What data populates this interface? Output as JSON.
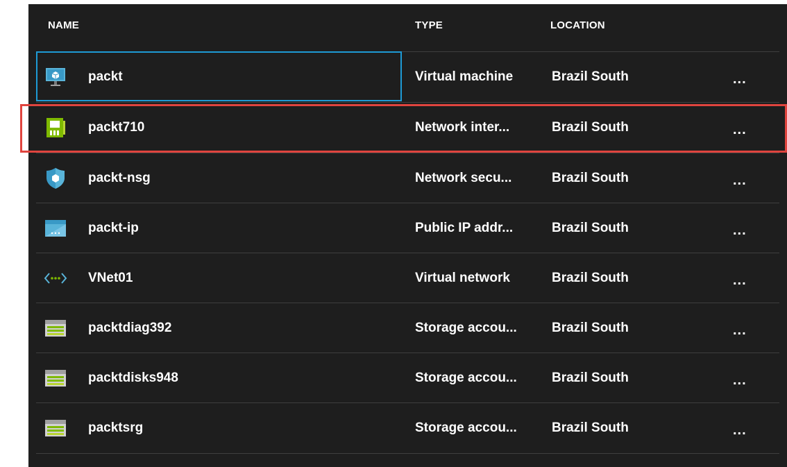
{
  "header": {
    "name": "NAME",
    "type": "TYPE",
    "location": "LOCATION"
  },
  "rows": [
    {
      "name": "packt",
      "type": "Virtual machine",
      "location": "Brazil South",
      "icon": "virtual-machine-icon",
      "more": "..."
    },
    {
      "name": "packt710",
      "type": "Network inter...",
      "location": "Brazil South",
      "icon": "network-interface-icon",
      "more": "..."
    },
    {
      "name": "packt-nsg",
      "type": "Network secu...",
      "location": "Brazil South",
      "icon": "shield-icon",
      "more": "..."
    },
    {
      "name": "packt-ip",
      "type": "Public IP addr...",
      "location": "Brazil South",
      "icon": "public-ip-icon",
      "more": "..."
    },
    {
      "name": "VNet01",
      "type": "Virtual network",
      "location": "Brazil South",
      "icon": "virtual-network-icon",
      "more": "..."
    },
    {
      "name": "packtdiag392",
      "type": "Storage accou...",
      "location": "Brazil South",
      "icon": "storage-account-icon",
      "more": "..."
    },
    {
      "name": "packtdisks948",
      "type": "Storage accou...",
      "location": "Brazil South",
      "icon": "storage-account-icon",
      "more": "..."
    },
    {
      "name": "packtsrg",
      "type": "Storage accou...",
      "location": "Brazil South",
      "icon": "storage-account-icon",
      "more": "..."
    }
  ],
  "colors": {
    "background": "#1e1e1e",
    "selection": "#1e9bd6",
    "highlight": "#e0443e"
  }
}
